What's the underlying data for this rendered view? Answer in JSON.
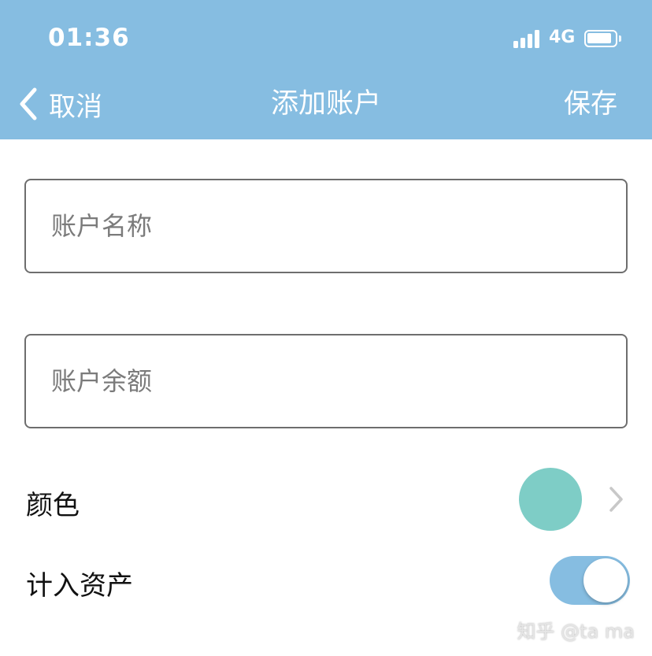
{
  "colors": {
    "header_bg": "#86bde1",
    "swatch": "#7ecdc6",
    "toggle_on": "#86bde1",
    "border": "#6e6e6e"
  },
  "status_bar": {
    "time": "01:36",
    "network": "4G"
  },
  "nav": {
    "back_label": "取消",
    "title": "添加账户",
    "save_label": "保存"
  },
  "form": {
    "name_placeholder": "账户名称",
    "name_value": "",
    "balance_placeholder": "账户余额",
    "balance_value": ""
  },
  "settings": {
    "color_label": "颜色",
    "include_label": "计入资产",
    "include_on": true
  },
  "watermark": "知乎 @ta ma"
}
